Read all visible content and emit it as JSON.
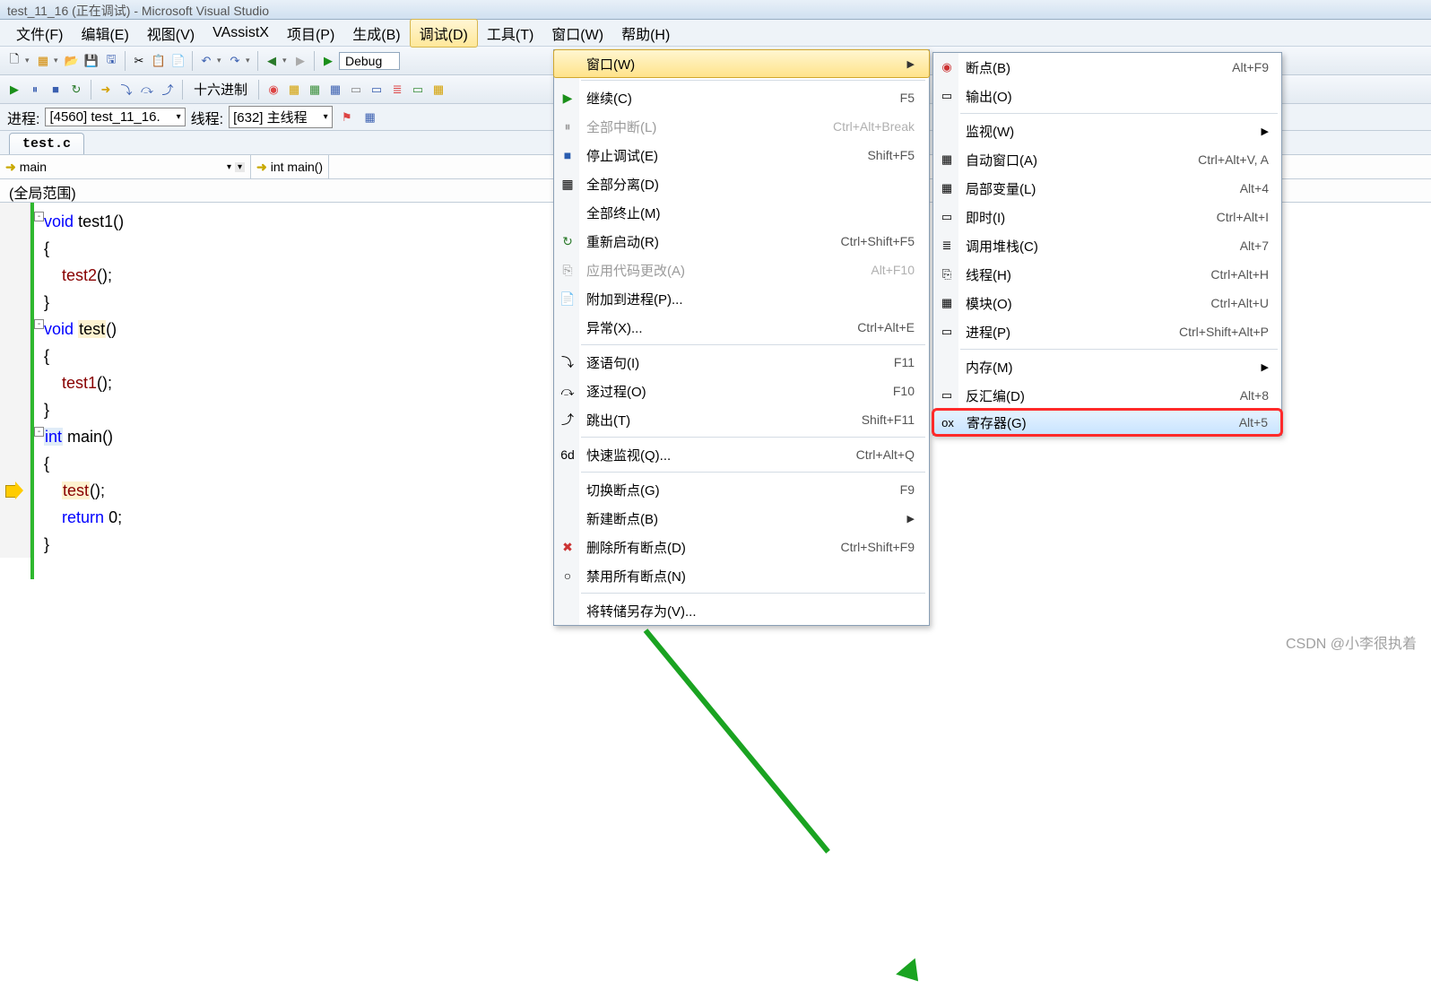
{
  "title": "test_11_16 (正在调试) - Microsoft Visual Studio",
  "menubar": [
    {
      "label": "文件(F)"
    },
    {
      "label": "编辑(E)"
    },
    {
      "label": "视图(V)"
    },
    {
      "label": "VAssistX"
    },
    {
      "label": "项目(P)"
    },
    {
      "label": "生成(B)"
    },
    {
      "label": "调试(D)"
    },
    {
      "label": "工具(T)"
    },
    {
      "label": "窗口(W)"
    },
    {
      "label": "帮助(H)"
    }
  ],
  "config": "Debug",
  "hex_label": "十六进制",
  "process": {
    "label": "进程:",
    "value": "[4560] test_11_16.",
    "thread_label": "线程:",
    "thread_value": "[632] 主线程"
  },
  "file_tab": "test.c",
  "nav": {
    "seg1": "main",
    "seg2": "int main()"
  },
  "scope": "(全局范围)",
  "code": [
    {
      "t": "void_decl",
      "kw": "void",
      "name": "test1",
      "rest": "()"
    },
    {
      "t": "brace",
      "txt": "{"
    },
    {
      "t": "call",
      "indent": 1,
      "name": "test2",
      "rest": "();"
    },
    {
      "t": "brace",
      "txt": "}"
    },
    {
      "t": "void_decl",
      "kw": "void",
      "name": "test",
      "rest": "()"
    },
    {
      "t": "brace",
      "txt": "{"
    },
    {
      "t": "call",
      "indent": 1,
      "name": "test1",
      "rest": "();"
    },
    {
      "t": "brace",
      "txt": "}"
    },
    {
      "t": "int_decl",
      "kw": "int",
      "name": "main",
      "rest": "()"
    },
    {
      "t": "brace",
      "txt": "{"
    },
    {
      "t": "call_bp",
      "indent": 1,
      "name": "test",
      "rest": "();"
    },
    {
      "t": "return",
      "indent": 1,
      "kw": "return",
      "val": "0",
      "rest": ";"
    },
    {
      "t": "brace",
      "txt": "}"
    }
  ],
  "debug_menu": [
    {
      "label": "窗口(W)",
      "submenu": true,
      "hover": true,
      "icon": ""
    },
    {
      "sep": true
    },
    {
      "label": "继续(C)",
      "shortcut": "F5",
      "icon": "▶",
      "color": "#1a8f1a"
    },
    {
      "label": "全部中断(L)",
      "shortcut": "Ctrl+Alt+Break",
      "icon": "⏸",
      "disabled": true
    },
    {
      "label": "停止调试(E)",
      "shortcut": "Shift+F5",
      "icon": "■",
      "color": "#2a5db0"
    },
    {
      "label": "全部分离(D)",
      "icon": "▦"
    },
    {
      "label": "全部终止(M)"
    },
    {
      "label": "重新启动(R)",
      "shortcut": "Ctrl+Shift+F5",
      "icon": "↻",
      "color": "#2a7a2a"
    },
    {
      "label": "应用代码更改(A)",
      "shortcut": "Alt+F10",
      "icon": "⎘",
      "disabled": true
    },
    {
      "label": "附加到进程(P)...",
      "icon": "📄"
    },
    {
      "label": "异常(X)...",
      "shortcut": "Ctrl+Alt+E"
    },
    {
      "sep": true
    },
    {
      "label": "逐语句(I)",
      "shortcut": "F11",
      "icon": "⤵"
    },
    {
      "label": "逐过程(O)",
      "shortcut": "F10",
      "icon": "⤼"
    },
    {
      "label": "跳出(T)",
      "shortcut": "Shift+F11",
      "icon": "⤴"
    },
    {
      "sep": true
    },
    {
      "label": "快速监视(Q)...",
      "shortcut": "Ctrl+Alt+Q",
      "icon": "6d"
    },
    {
      "sep": true
    },
    {
      "label": "切换断点(G)",
      "shortcut": "F9"
    },
    {
      "label": "新建断点(B)",
      "submenu": true
    },
    {
      "label": "删除所有断点(D)",
      "shortcut": "Ctrl+Shift+F9",
      "icon": "✖",
      "color": "#c33"
    },
    {
      "label": "禁用所有断点(N)",
      "icon": "○"
    },
    {
      "sep": true
    },
    {
      "label": "将转储另存为(V)..."
    }
  ],
  "window_submenu": [
    {
      "label": "断点(B)",
      "shortcut": "Alt+F9",
      "icon": "◉",
      "color": "#c33"
    },
    {
      "label": "输出(O)",
      "icon": "▭"
    },
    {
      "sep": true
    },
    {
      "label": "监视(W)",
      "submenu": true
    },
    {
      "label": "自动窗口(A)",
      "shortcut": "Ctrl+Alt+V, A",
      "icon": "▦"
    },
    {
      "label": "局部变量(L)",
      "shortcut": "Alt+4",
      "icon": "▦"
    },
    {
      "label": "即时(I)",
      "shortcut": "Ctrl+Alt+I",
      "icon": "▭"
    },
    {
      "label": "调用堆栈(C)",
      "shortcut": "Alt+7",
      "icon": "≣"
    },
    {
      "label": "线程(H)",
      "shortcut": "Ctrl+Alt+H",
      "icon": "⎘"
    },
    {
      "label": "模块(O)",
      "shortcut": "Ctrl+Alt+U",
      "icon": "▦"
    },
    {
      "label": "进程(P)",
      "shortcut": "Ctrl+Shift+Alt+P",
      "icon": "▭"
    },
    {
      "sep": true
    },
    {
      "label": "内存(M)",
      "submenu": true
    },
    {
      "label": "反汇编(D)",
      "shortcut": "Alt+8",
      "icon": "▭"
    },
    {
      "label": "寄存器(G)",
      "shortcut": "Alt+5",
      "icon": "ox",
      "highlighted": true
    }
  ],
  "watermark": "CSDN @小李很执着"
}
